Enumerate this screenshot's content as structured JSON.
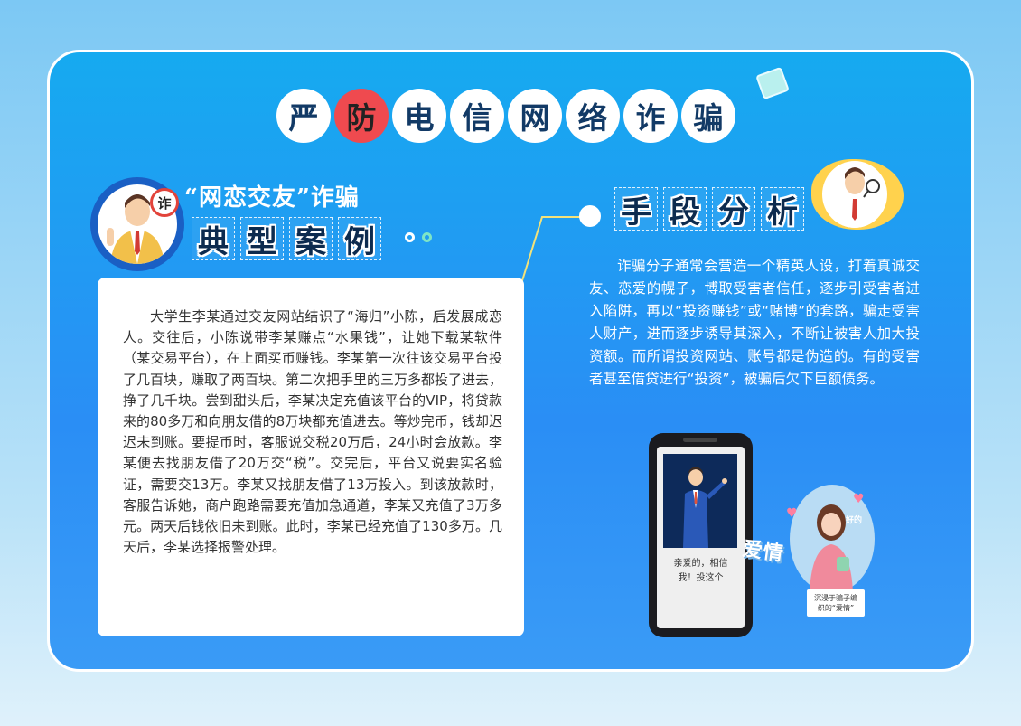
{
  "title": {
    "chars": [
      "严",
      "防",
      "电",
      "信",
      "网",
      "络",
      "诈",
      "骗"
    ],
    "highlight_index": 1,
    "highlight_color": "#ef4a4f"
  },
  "left_section": {
    "badge_char": "诈",
    "subheading": "“网恋交友”诈骗",
    "heading_chars": [
      "典",
      "型",
      "案",
      "例"
    ],
    "body": "大学生李某通过交友网站结识了“海归”小陈，后发展成恋人。交往后，小陈说带李某赚点“水果钱”，让她下载某软件（某交易平台），在上面买币赚钱。李某第一次往该交易平台投了几百块，赚取了两百块。第二次把手里的三万多都投了进去，挣了几千块。尝到甜头后，李某决定充值该平台的VIP，将贷款来的80多万和向朋友借的8万块都充值进去。等炒完币，钱却迟迟未到账。要提币时，客服说交税20万后，24小时会放款。李某便去找朋友借了20万交“税”。交完后，平台又说要实名验证，需要交13万。李某又找朋友借了13万投入。到该放款时，客服告诉她，商户跑路需要充值加急通道，李某又充值了3万多元。两天后钱依旧未到账。此时，李某已经充值了130多万。几天后，李某选择报警处理。"
  },
  "right_section": {
    "heading_chars": [
      "手",
      "段",
      "分",
      "析"
    ],
    "body": "诈骗分子通常会营造一个精英人设，打着真诚交友、恋爱的幌子，博取受害者信任，逐步引受害者进入陷阱，再以“投资赚钱”或“赌博”的套路，骗走受害人财产，进而逐步诱导其深入，不断让被害人加大投资额。而所谓投资网站、账号都是伪造的。有的受害者甚至借贷进行“投资”，被骗后欠下巨额债务。"
  },
  "illustration": {
    "phone_message_line1": "亲爱的，相信",
    "phone_message_line2": "我！投这个",
    "love_word": "爱情",
    "girl_bubble": "好的",
    "girl_caption_line1": "沉浸于骗子编",
    "girl_caption_line2": "织的“爱情”"
  },
  "colors": {
    "poster_top": "#16aaf0",
    "poster_bottom": "#3a9bf6",
    "heading_text": "#0d2b4f",
    "connector": "#f3e27a"
  }
}
